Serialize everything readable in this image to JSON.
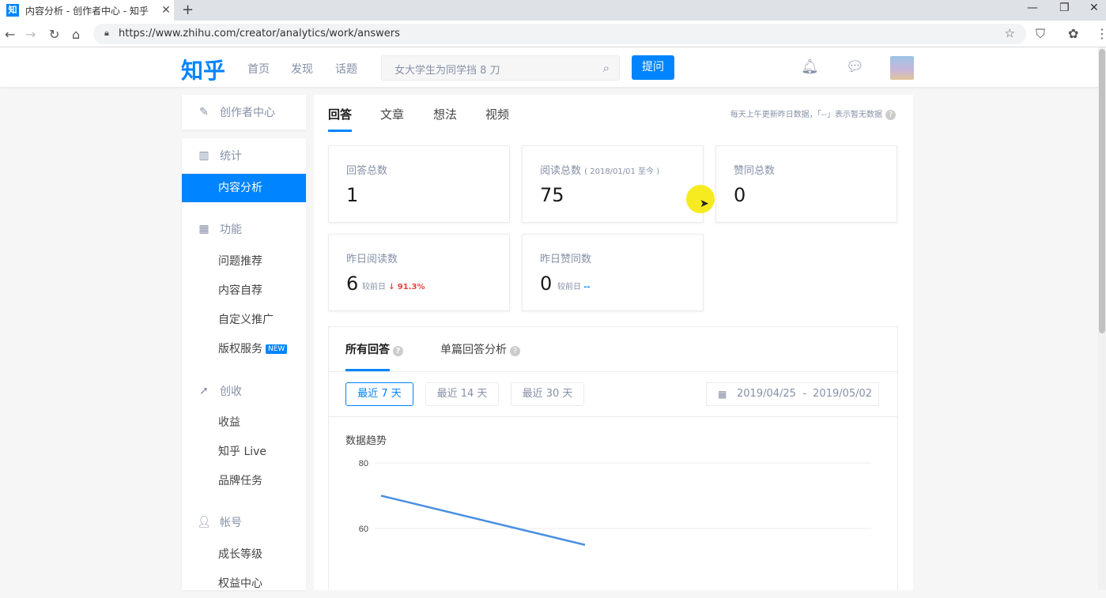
{
  "browser": {
    "tab_title": "内容分析 - 创作者中心 - 知乎",
    "tab_favicon": "知",
    "tab_close": "✕",
    "new_tab": "+",
    "url": "https://www.zhihu.com/creator/analytics/work/answers",
    "minimize": "—",
    "maximize": "❐",
    "close": "✕"
  },
  "header": {
    "logo": "知乎",
    "nav": [
      "首页",
      "发现",
      "话题"
    ],
    "search_placeholder": "女大学生为同学挡 8 刀",
    "ask_button": "提问"
  },
  "sidebar": {
    "creator_center": "创作者中心",
    "stats_head": "统计",
    "content_analysis": "内容分析",
    "function_head": "功能",
    "function_items": [
      "问题推荐",
      "内容自荐",
      "自定义推广",
      "版权服务"
    ],
    "new_badge": "NEW",
    "income_head": "创收",
    "income_items": [
      "收益",
      "知乎 Live",
      "品牌任务"
    ],
    "account_head": "帐号",
    "account_items": [
      "成长等级",
      "权益中心"
    ]
  },
  "main": {
    "tabs": [
      "回答",
      "文章",
      "想法",
      "视频"
    ],
    "notice": "每天上午更新昨日数据，「--」表示暂无数据",
    "stats": {
      "total_answers_label": "回答总数",
      "total_answers": "1",
      "total_reads_label": "阅读总数",
      "total_reads_note": "( 2018/01/01 至今 )",
      "total_reads": "75",
      "total_likes_label": "赞同总数",
      "total_likes": "0",
      "yesterday_reads_label": "昨日阅读数",
      "yesterday_reads": "6",
      "yesterday_reads_cmp": "较前日",
      "yesterday_reads_change": "91.3%",
      "yesterday_likes_label": "昨日赞同数",
      "yesterday_likes": "0",
      "yesterday_likes_cmp": "较前日",
      "yesterday_likes_change": "--"
    },
    "sub_tabs": [
      "所有回答",
      "单篇回答分析"
    ],
    "ranges": [
      "最近 7 天",
      "最近 14 天",
      "最近 30 天"
    ],
    "date_range": "2019/04/25  -  2019/05/02",
    "trend_title": "数据趋势"
  },
  "chart_data": {
    "type": "line",
    "title": "数据趋势",
    "y_ticks": [
      80,
      60
    ],
    "series": [
      {
        "values": [
          70,
          55
        ]
      }
    ],
    "color": "#4a90e2"
  }
}
